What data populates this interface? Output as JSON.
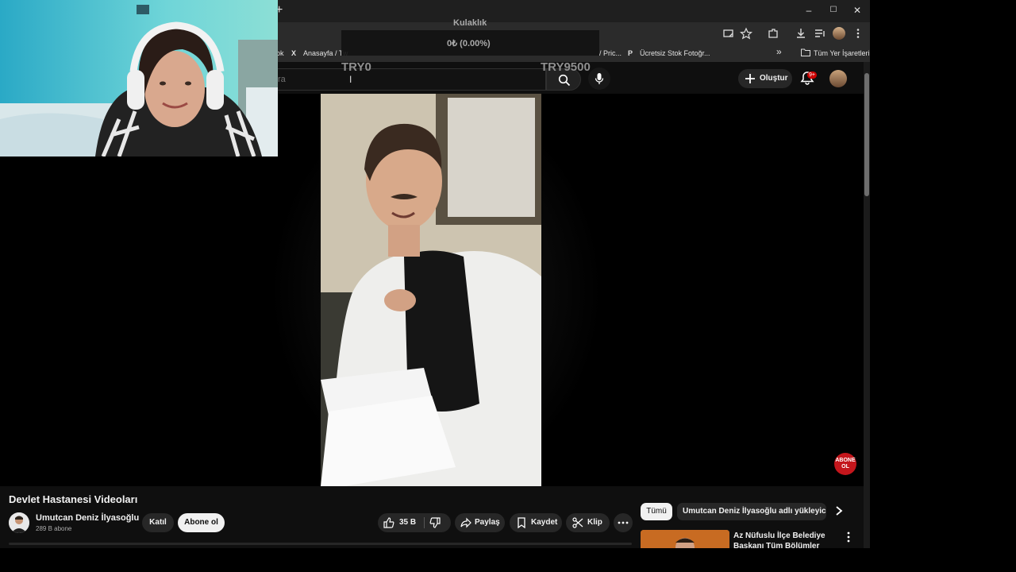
{
  "browser": {
    "new_tab_label": "+",
    "window_controls": {
      "minimize": "–",
      "maximize": "☐",
      "close": "✕"
    },
    "bookmarks": [
      {
        "label": "ok",
        "icon": "bookmark"
      },
      {
        "label": "Anasayfa / Tw",
        "icon": "x-logo-icon"
      },
      {
        "label": "/ Pric...",
        "icon": ""
      },
      {
        "label": "Ücretsiz Stok Fotoğr...",
        "icon": "pexels-icon"
      }
    ],
    "bookmarks_more": "»",
    "all_bookmarks_label": "Tüm Yer İşaretleri"
  },
  "overlay": {
    "device_label": "Kulaklık",
    "device_value": "0₺ (0.00%)",
    "min_label": "TRY0",
    "max_label": "TRY9500"
  },
  "header": {
    "search_placeholder": "ra",
    "create_label": "Oluştur",
    "notification_count": "9+"
  },
  "video": {
    "title": "Devlet Hastanesi Videoları",
    "channel_name": "Umutcan Deniz İlyasoğlu",
    "subscribers": "289 B abone",
    "join_label": "Katıl",
    "subscribe_label": "Abone ol",
    "like_count": "35 B",
    "share_label": "Paylaş",
    "save_label": "Kaydet",
    "clip_label": "Klip",
    "abone_badge": "ABONE OL"
  },
  "sidebar": {
    "chips": [
      "Tümü",
      "Umutcan Deniz İlyasoğlu adlı yükleyiciden"
    ],
    "recommendation_title": "Az Nüfuslu İlçe Belediye Başkanı Tüm Bölümler"
  },
  "colors": {
    "background": "#0f0f0f",
    "chip_active": "#f1f1f1",
    "badge_red": "#cc0000"
  }
}
